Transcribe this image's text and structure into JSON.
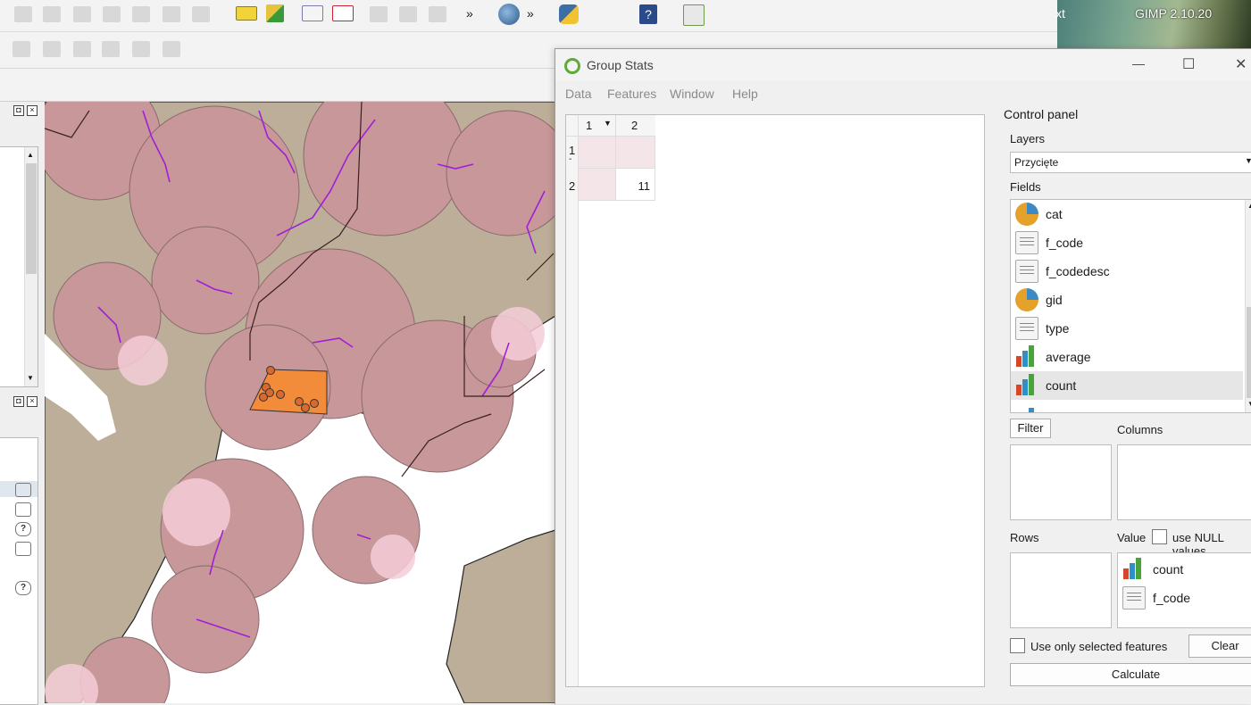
{
  "gimp_taskbar": {
    "left_text": "xt",
    "title": "GIMP 2.10.20"
  },
  "dialog": {
    "title": "Group Stats",
    "menus": [
      "Data",
      "Features",
      "Window",
      "Help"
    ],
    "window_controls": {
      "minimize": "—",
      "maximize": "☐",
      "close": "✕"
    }
  },
  "table": {
    "column_headers": [
      "1",
      "2"
    ],
    "row_headers": [
      "1",
      "2"
    ],
    "row1_sub": "-",
    "cells": [
      [
        "",
        ""
      ],
      [
        "",
        "11"
      ]
    ]
  },
  "control_panel": {
    "title": "Control panel",
    "layers_label": "Layers",
    "layer_selected": "Przycięte",
    "fields_label": "Fields",
    "fields": [
      {
        "name": "cat",
        "icon": "pie-icon"
      },
      {
        "name": "f_code",
        "icon": "text-icon"
      },
      {
        "name": "f_codedesc",
        "icon": "text-icon"
      },
      {
        "name": "gid",
        "icon": "pie-icon"
      },
      {
        "name": "type",
        "icon": "text-icon"
      },
      {
        "name": "average",
        "icon": "bar-icon"
      },
      {
        "name": "count",
        "icon": "bar-icon"
      }
    ],
    "filter_button": "Filter",
    "columns_label": "Columns",
    "rows_label": "Rows",
    "value_label": "Value",
    "use_null_label": "use NULL values",
    "value_items": [
      {
        "name": "count",
        "icon": "bar-icon"
      },
      {
        "name": "f_code",
        "icon": "text-icon"
      }
    ],
    "use_selected_label": "Use only selected features",
    "clear_button": "Clear",
    "calculate_button": "Calculate"
  },
  "colors": {
    "buffer_fill": "#c7979a",
    "land_fill": "#bcae98",
    "pink_fill": "#f4cdd8",
    "river": "#a21ed8",
    "selected_fill": "#f28b3a",
    "qgis_green": "#5fa83a"
  }
}
